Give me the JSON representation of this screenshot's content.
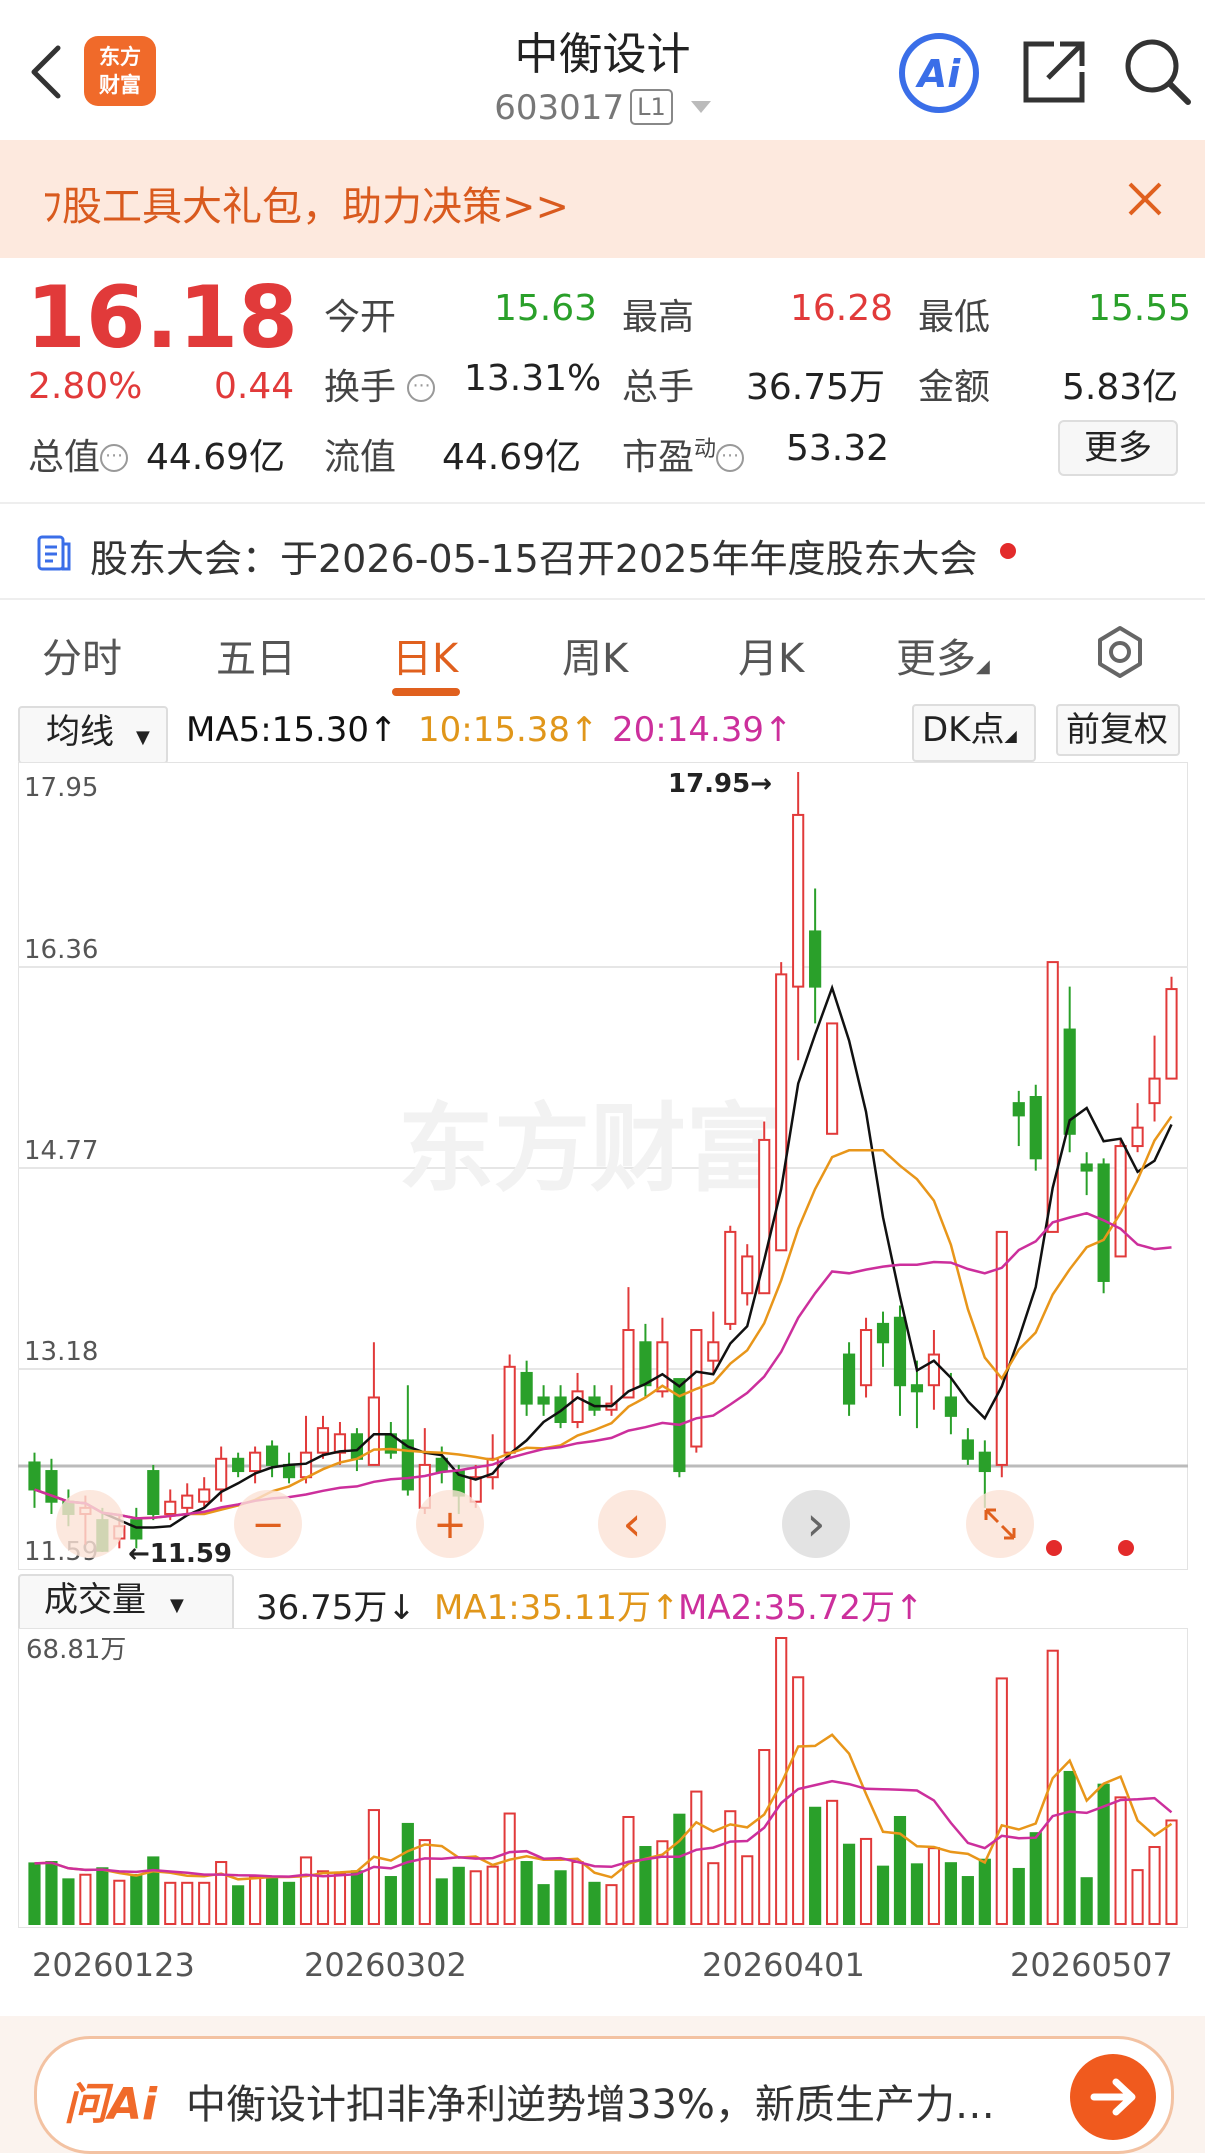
{
  "header": {
    "title": "中衡设计",
    "code": "603017",
    "level": "L1",
    "logo_text_1": "东方",
    "logo_text_2": "财富",
    "ai_label": "Ai"
  },
  "banner": {
    "text": "ﾌ股工具大礼包，助力决策>>"
  },
  "quote": {
    "price": "16.18",
    "change_pct": "2.80%",
    "change": "0.44",
    "open_label": "今开",
    "open": "15.63",
    "high_label": "最高",
    "high": "16.28",
    "low_label": "最低",
    "low": "15.55",
    "turnover_label": "换手",
    "turnover": "13.31%",
    "volume_label": "总手",
    "volume": "36.75万",
    "amount_label": "金额",
    "amount": "5.83亿",
    "mktcap_label": "总值",
    "mktcap": "44.69亿",
    "float_label": "流值",
    "float_cap": "44.69亿",
    "pe_label": "市盈",
    "pe_sup": "动",
    "pe": "53.32",
    "more": "更多",
    "info_glyph": "⋯"
  },
  "notice": {
    "text": "股东大会：于2026-05-15召开2025年年度股东大会"
  },
  "tabs": [
    "分时",
    "五日",
    "日K",
    "周K",
    "月K",
    "更多"
  ],
  "kline": {
    "selector": "均线",
    "ma5": "MA5:15.30↑",
    "ma10": "10:15.38↑",
    "ma20": "20:14.39↑",
    "dk": "DK点",
    "adjust": "前复权",
    "y_labels": [
      "17.95",
      "16.36",
      "14.77",
      "13.18",
      "11.59"
    ],
    "high_marker": "17.95→",
    "low_marker": "←11.59",
    "watermark": "东方财富",
    "zoom_out": "−",
    "zoom_in": "+",
    "prev": "‹",
    "next": "›"
  },
  "volume": {
    "selector": "成交量",
    "value": "36.75万↓",
    "ma1": "MA1:35.11万↑",
    "ma2": "MA2:35.72万↑",
    "max_label": "68.81万"
  },
  "dates": [
    "20260123",
    "20260302",
    "20260401",
    "20260507"
  ],
  "ai_bar": {
    "logo": "问Ai",
    "text": "中衡设计扣非净利逆势增33%，新质生产力…"
  },
  "colors": {
    "up": "#e13a3a",
    "down": "#2aa02a",
    "ma5": "#111111",
    "ma10": "#e8961a",
    "ma20": "#cc2f9c",
    "accent": "#f06a2a"
  },
  "chart_data": {
    "type": "candlestick",
    "ylim": [
      11.59,
      17.95
    ],
    "candles": [
      {
        "o": 12.32,
        "c": 12.1,
        "h": 12.4,
        "l": 11.95
      },
      {
        "o": 12.25,
        "c": 12.0,
        "h": 12.35,
        "l": 11.9
      },
      {
        "o": 12.0,
        "c": 11.9,
        "h": 12.1,
        "l": 11.8
      },
      {
        "o": 11.9,
        "c": 11.95,
        "h": 12.05,
        "l": 11.65
      },
      {
        "o": 11.85,
        "c": 11.6,
        "h": 11.95,
        "l": 11.59
      },
      {
        "o": 11.7,
        "c": 11.8,
        "h": 11.9,
        "l": 11.62
      },
      {
        "o": 11.85,
        "c": 11.7,
        "h": 11.95,
        "l": 11.62
      },
      {
        "o": 12.25,
        "c": 11.9,
        "h": 12.3,
        "l": 11.85
      },
      {
        "o": 11.9,
        "c": 12.0,
        "h": 12.1,
        "l": 11.85
      },
      {
        "o": 11.95,
        "c": 12.05,
        "h": 12.15,
        "l": 11.9
      },
      {
        "o": 12.0,
        "c": 12.1,
        "h": 12.2,
        "l": 11.95
      },
      {
        "o": 12.1,
        "c": 12.35,
        "h": 12.45,
        "l": 12.0
      },
      {
        "o": 12.35,
        "c": 12.25,
        "h": 12.4,
        "l": 12.2
      },
      {
        "o": 12.25,
        "c": 12.4,
        "h": 12.45,
        "l": 12.15
      },
      {
        "o": 12.45,
        "c": 12.3,
        "h": 12.5,
        "l": 12.2
      },
      {
        "o": 12.3,
        "c": 12.2,
        "h": 12.4,
        "l": 12.15
      },
      {
        "o": 12.2,
        "c": 12.4,
        "h": 12.7,
        "l": 12.15
      },
      {
        "o": 12.4,
        "c": 12.6,
        "h": 12.7,
        "l": 12.35
      },
      {
        "o": 12.4,
        "c": 12.55,
        "h": 12.65,
        "l": 12.3
      },
      {
        "o": 12.55,
        "c": 12.35,
        "h": 12.6,
        "l": 12.25
      },
      {
        "o": 12.3,
        "c": 12.85,
        "h": 13.3,
        "l": 12.3
      },
      {
        "o": 12.55,
        "c": 12.4,
        "h": 12.65,
        "l": 12.35
      },
      {
        "o": 12.5,
        "c": 12.1,
        "h": 12.95,
        "l": 12.05
      },
      {
        "o": 11.95,
        "c": 12.3,
        "h": 12.6,
        "l": 11.9
      },
      {
        "o": 12.35,
        "c": 12.25,
        "h": 12.45,
        "l": 12.15
      },
      {
        "o": 12.25,
        "c": 12.05,
        "h": 12.3,
        "l": 11.9
      },
      {
        "o": 12.0,
        "c": 12.2,
        "h": 12.3,
        "l": 11.95
      },
      {
        "o": 12.2,
        "c": 12.35,
        "h": 12.55,
        "l": 12.1
      },
      {
        "o": 12.4,
        "c": 13.1,
        "h": 13.2,
        "l": 12.35
      },
      {
        "o": 13.05,
        "c": 12.8,
        "h": 13.15,
        "l": 12.7
      },
      {
        "o": 12.85,
        "c": 12.8,
        "h": 12.95,
        "l": 12.7
      },
      {
        "o": 12.85,
        "c": 12.65,
        "h": 12.95,
        "l": 12.6
      },
      {
        "o": 12.65,
        "c": 12.9,
        "h": 13.05,
        "l": 12.6
      },
      {
        "o": 12.85,
        "c": 12.75,
        "h": 12.95,
        "l": 12.7
      },
      {
        "o": 12.75,
        "c": 12.8,
        "h": 12.95,
        "l": 12.7
      },
      {
        "o": 12.85,
        "c": 13.4,
        "h": 13.75,
        "l": 12.85
      },
      {
        "o": 13.3,
        "c": 12.95,
        "h": 13.45,
        "l": 12.85
      },
      {
        "o": 12.9,
        "c": 13.3,
        "h": 13.5,
        "l": 12.85
      },
      {
        "o": 13.0,
        "c": 12.25,
        "h": 13.0,
        "l": 12.2
      },
      {
        "o": 12.45,
        "c": 13.4,
        "h": 13.4,
        "l": 12.4
      },
      {
        "o": 13.15,
        "c": 13.3,
        "h": 13.55,
        "l": 13.05
      },
      {
        "o": 13.45,
        "c": 14.2,
        "h": 14.25,
        "l": 13.4
      },
      {
        "o": 13.7,
        "c": 14.0,
        "h": 14.1,
        "l": 13.6
      },
      {
        "o": 13.7,
        "c": 14.95,
        "h": 15.1,
        "l": 13.7
      },
      {
        "o": 14.05,
        "c": 16.3,
        "h": 16.4,
        "l": 14.05
      },
      {
        "o": 16.2,
        "c": 17.6,
        "h": 17.95,
        "l": 15.6
      },
      {
        "o": 16.65,
        "c": 16.2,
        "h": 17.0,
        "l": 15.9
      },
      {
        "o": 15.0,
        "c": 15.9,
        "h": 15.9,
        "l": 15.0
      },
      {
        "o": 13.2,
        "c": 12.8,
        "h": 13.3,
        "l": 12.7
      },
      {
        "o": 12.95,
        "c": 13.4,
        "h": 13.5,
        "l": 12.85
      },
      {
        "o": 13.45,
        "c": 13.3,
        "h": 13.55,
        "l": 13.1
      },
      {
        "o": 13.5,
        "c": 12.95,
        "h": 13.6,
        "l": 12.7
      },
      {
        "o": 12.95,
        "c": 12.9,
        "h": 13.15,
        "l": 12.6
      },
      {
        "o": 12.95,
        "c": 13.2,
        "h": 13.4,
        "l": 12.75
      },
      {
        "o": 12.85,
        "c": 12.7,
        "h": 13.05,
        "l": 12.55
      },
      {
        "o": 12.5,
        "c": 12.35,
        "h": 12.6,
        "l": 12.3
      },
      {
        "o": 12.4,
        "c": 12.25,
        "h": 12.5,
        "l": 11.95
      },
      {
        "o": 12.3,
        "c": 14.2,
        "h": 14.2,
        "l": 12.2
      },
      {
        "o": 15.25,
        "c": 15.15,
        "h": 15.35,
        "l": 14.9
      },
      {
        "o": 15.3,
        "c": 14.8,
        "h": 15.4,
        "l": 14.7
      },
      {
        "o": 14.2,
        "c": 16.4,
        "h": 16.4,
        "l": 14.2
      },
      {
        "o": 15.85,
        "c": 15.0,
        "h": 16.2,
        "l": 14.85
      },
      {
        "o": 14.75,
        "c": 14.7,
        "h": 14.85,
        "l": 14.5
      },
      {
        "o": 14.75,
        "c": 13.8,
        "h": 14.8,
        "l": 13.7
      },
      {
        "o": 14.0,
        "c": 14.9,
        "h": 14.95,
        "l": 14.0
      },
      {
        "o": 14.9,
        "c": 15.05,
        "h": 15.25,
        "l": 14.85
      },
      {
        "o": 15.25,
        "c": 15.45,
        "h": 15.8,
        "l": 15.1
      },
      {
        "o": 15.45,
        "c": 16.18,
        "h": 16.28,
        "l": 15.55
      }
    ],
    "volume_max": "68.81万"
  }
}
